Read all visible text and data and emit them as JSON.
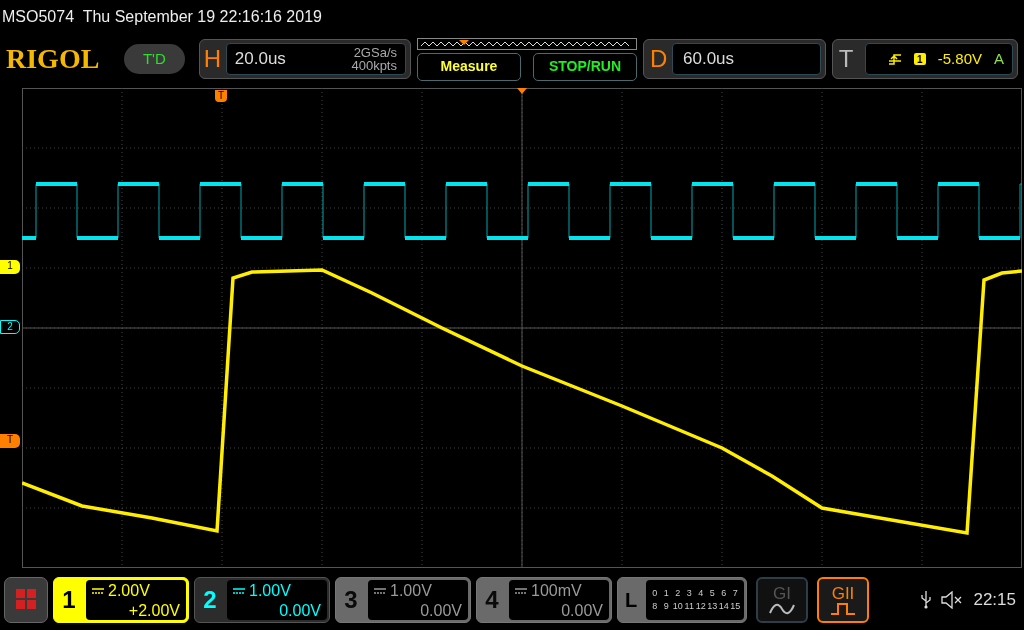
{
  "status_line": "MSO5074  Thu September 19 22:16:16 2019",
  "logo": "RIGOL",
  "run_state": "T'D",
  "horizontal": {
    "label": "H",
    "timebase": "20.0us",
    "sample_rate": "2GSa/s",
    "memory_depth": "400kpts"
  },
  "buttons": [
    {
      "label": "Measure",
      "kind": "measure"
    },
    {
      "label": "STOP/RUN",
      "kind": "run"
    }
  ],
  "delay": {
    "label": "D",
    "value": "60.0us"
  },
  "trigger": {
    "label": "T",
    "source": "1",
    "level": "-5.80V",
    "mode": "A"
  },
  "trigger_position_marker": "T",
  "channel_markers": [
    {
      "label": "1",
      "kind": "ch1"
    },
    {
      "label": "2",
      "kind": "ch2"
    },
    {
      "label": "T",
      "kind": "trigger"
    }
  ],
  "channels": [
    {
      "number": "1",
      "scale": "2.00V",
      "offset": "+2.00V",
      "on": true,
      "selected": true,
      "color": "#ffff00"
    },
    {
      "number": "2",
      "scale": "1.00V",
      "offset": "0.00V",
      "on": true,
      "selected": false,
      "color": "#00ffff"
    },
    {
      "number": "3",
      "scale": "1.00V",
      "offset": "0.00V",
      "on": false,
      "selected": false
    },
    {
      "number": "4",
      "scale": "100mV",
      "offset": "0.00V",
      "on": false,
      "selected": false
    }
  ],
  "logic": {
    "label": "L",
    "rows": [
      [
        "0",
        "1",
        "2",
        "3",
        "4",
        "5",
        "6",
        "7"
      ],
      [
        "8",
        "9",
        "10",
        "11",
        "12",
        "13",
        "14",
        "15"
      ]
    ]
  },
  "generators": [
    {
      "label": "GI",
      "on": false,
      "kind": "sine"
    },
    {
      "label": "GII",
      "on": true,
      "kind": "pulse"
    }
  ],
  "clock": "22:15"
}
